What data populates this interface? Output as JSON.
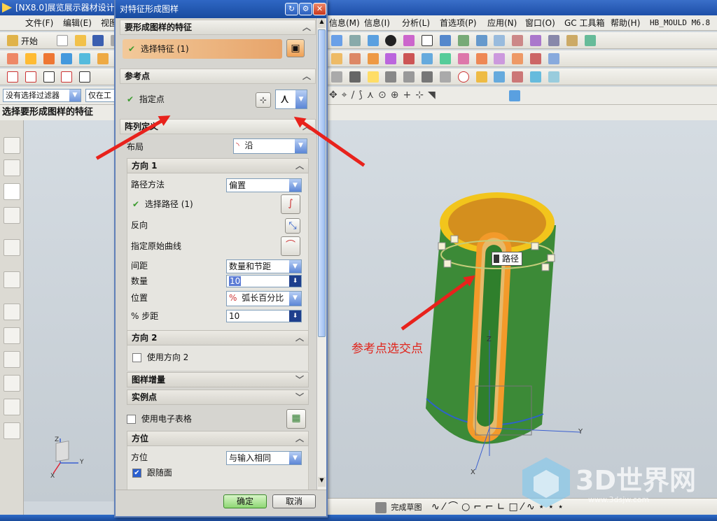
{
  "app": {
    "title": "[NX8.0]展览展示器材设计",
    "menus": [
      "文件(F)",
      "编辑(E)",
      "视图",
      "信息(M)",
      "信息(I)",
      "分析(L)",
      "首选项(P)",
      "应用(N)",
      "窗口(O)",
      "GC 工具箱",
      "帮助(H)",
      "HB_MOULD M6.8"
    ],
    "start_label": "开始",
    "filter_value": "没有选择过滤器",
    "scope_value": "仅在工",
    "status_prompt": "选择要形成图样的特征",
    "bottom_label": "完成草图"
  },
  "dialog": {
    "title": "对特征形成图样",
    "sec_features": "要形成图样的特征",
    "select_feature": "选择特征 (1)",
    "sec_refpoint": "参考点",
    "specify_point": "指定点",
    "sec_array_def": "阵列定义",
    "layout_label": "布局",
    "layout_value": "沿",
    "dir1": {
      "header": "方向 1",
      "path_method_label": "路径方法",
      "path_method_value": "偏置",
      "select_path": "选择路径 (1)",
      "reverse_label": "反向",
      "origin_curve_label": "指定原始曲线",
      "spacing_label": "间距",
      "spacing_value": "数量和节距",
      "count_label": "数量",
      "count_value": "10",
      "position_label": "位置",
      "position_value": "弧长百分比",
      "step_label": "% 步距",
      "step_value": "10"
    },
    "dir2": {
      "header": "方向 2",
      "use_dir2": "使用方向 2"
    },
    "pattern_increment": "图样增量",
    "instance_points": "实例点",
    "use_spreadsheet": "使用电子表格",
    "orientation": {
      "header": "方位",
      "label": "方位",
      "value": "与输入相同",
      "follow_face": "跟随面"
    },
    "ok_label": "确定",
    "cancel_label": "取消"
  },
  "viewport": {
    "path_label": "路径",
    "axis_x": "X",
    "axis_y": "Y",
    "axis_z": "Z"
  },
  "annotation": {
    "text": "参考点选交点"
  },
  "watermark": {
    "brand": "3D世界网",
    "url": "www.3dsjw.com"
  },
  "colors": {
    "arrow_red": "#e8221c",
    "cylinder_green": "#3c8a37",
    "rim_yellow": "#f2c51c",
    "slot_orange": "#f39a2a",
    "dialog_title_blue": "#1d4fa8"
  }
}
